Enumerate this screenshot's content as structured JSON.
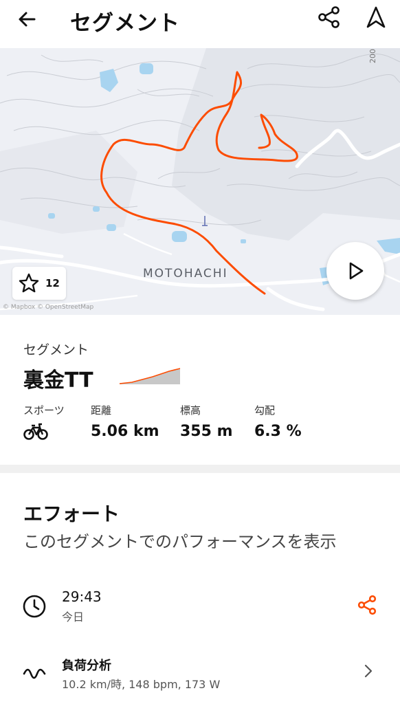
{
  "header": {
    "title": "セグメント"
  },
  "map": {
    "town_label": "MOTOHACHI",
    "elevation_label": "200 m",
    "attribution": "© Mapbox © OpenStreetMap",
    "star_count": "12"
  },
  "segment": {
    "kicker": "セグメント",
    "name": "裏金TT",
    "stats": [
      {
        "label": "スポーツ",
        "value": ""
      },
      {
        "label": "距離",
        "value": "5.06 km"
      },
      {
        "label": "標高",
        "value": "355 m"
      },
      {
        "label": "勾配",
        "value": "6.3 %"
      }
    ]
  },
  "effort": {
    "heading": "エフォート",
    "subtitle": "このセグメントでのパフォーマンスを表示",
    "time": "29:43",
    "time_when": "今日",
    "analysis_title": "負荷分析",
    "analysis_detail": "10.2 km/時, 148 bpm, 173 W"
  },
  "colors": {
    "accent": "#fc4c02",
    "water": "#a8d4f0",
    "map_bg": "#eef0f5"
  }
}
